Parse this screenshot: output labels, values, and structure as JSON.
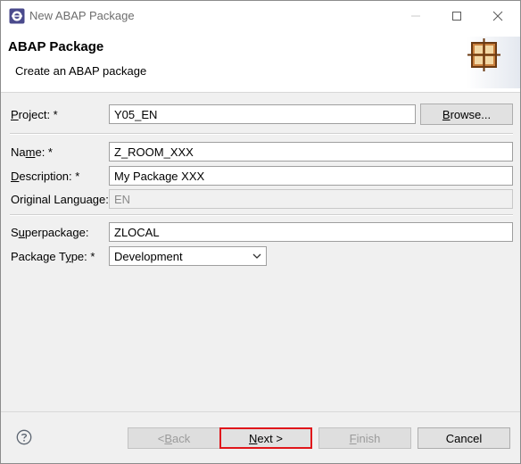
{
  "window": {
    "title": "New ABAP Package"
  },
  "banner": {
    "title": "ABAP Package",
    "subtitle": "Create an ABAP package"
  },
  "project": {
    "label_u": "P",
    "label_rest": "roject: *",
    "value": "Y05_EN",
    "browse_u": "B",
    "browse_rest": "rowse..."
  },
  "name": {
    "label_pre": "Na",
    "label_u": "m",
    "label_rest": "e: *",
    "value": "Z_ROOM_XXX"
  },
  "description": {
    "label_u": "D",
    "label_rest": "escription: *",
    "value": "My Package XXX"
  },
  "original_language": {
    "label_pre": "Original Lan",
    "label_u": "g",
    "label_rest": "uage:",
    "value": "EN"
  },
  "superpackage": {
    "label_pre": "S",
    "label_u": "u",
    "label_rest": "perpackage:",
    "value": "ZLOCAL"
  },
  "package_type": {
    "label_pre": "Package T",
    "label_u": "y",
    "label_rest": "pe: *",
    "value": "Development"
  },
  "buttons": {
    "back_pre": "< ",
    "back_u": "B",
    "back_rest": "ack",
    "next_u": "N",
    "next_rest": "ext >",
    "finish_u": "F",
    "finish_rest": "inish",
    "cancel": "Cancel"
  },
  "icons": [
    "eclipse-app-icon",
    "minimize-icon",
    "maximize-icon",
    "close-icon",
    "package-wizard-icon",
    "help-icon",
    "chevron-down-icon"
  ],
  "colors": {
    "focus_border": "#e0161b",
    "dialog_bg": "#f0f0f0"
  }
}
